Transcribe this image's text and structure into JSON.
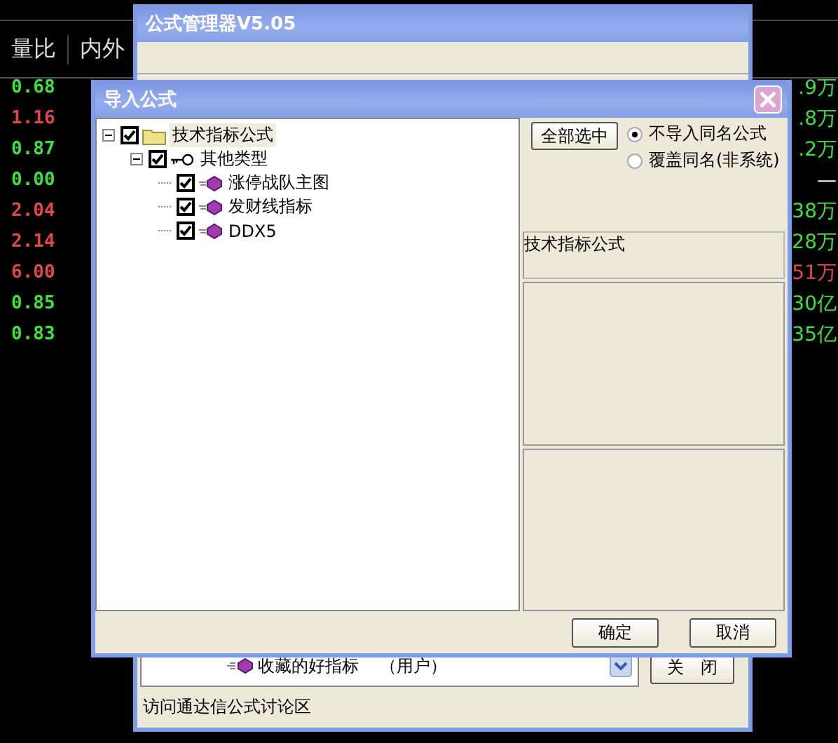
{
  "background_table": {
    "columns": [
      "量比",
      "内外"
    ],
    "left_values": [
      {
        "text": "0.68",
        "color": "#3ee03e"
      },
      {
        "text": "1.16",
        "color": "#e04848"
      },
      {
        "text": "0.87",
        "color": "#3ee03e"
      },
      {
        "text": "0.00",
        "color": "#3ee03e"
      },
      {
        "text": "2.04",
        "color": "#e04848"
      },
      {
        "text": "2.14",
        "color": "#e04848"
      },
      {
        "text": "6.00",
        "color": "#e04848"
      },
      {
        "text": "0.85",
        "color": "#3ee03e"
      },
      {
        "text": "0.83",
        "color": "#3ee03e"
      }
    ],
    "right_values": [
      {
        "text": ".9万",
        "color": "#3ee03e"
      },
      {
        "text": ".8万",
        "color": "#3ee03e"
      },
      {
        "text": ".2万",
        "color": "#3ee03e"
      },
      {
        "text": "—",
        "color": "#ffffff"
      },
      {
        "text": "38万",
        "color": "#3ee03e"
      },
      {
        "text": "28万",
        "color": "#3ee03e"
      },
      {
        "text": "51万",
        "color": "#e04848"
      },
      {
        "text": "30亿",
        "color": "#3ee03e"
      },
      {
        "text": "35亿",
        "color": "#3ee03e"
      }
    ]
  },
  "manager_window": {
    "title": "公式管理器V5.05",
    "list_item": {
      "label": "收藏的好指标",
      "tag": "（用户）"
    },
    "close_button": "关　闭",
    "status": "访问通达信公式讨论区"
  },
  "import_dialog": {
    "title": "导入公式",
    "tree": [
      {
        "label": "技术指标公式",
        "kind": "folder",
        "checked": true,
        "expanded": true,
        "selected": true,
        "children": [
          {
            "label": "其他类型",
            "kind": "key",
            "checked": true,
            "expanded": true,
            "selected": false,
            "children": [
              {
                "label": "涨停战队主图",
                "kind": "formula",
                "checked": true,
                "selected": false
              },
              {
                "label": "发财线指标",
                "kind": "formula",
                "checked": true,
                "selected": false
              },
              {
                "label": "DDX5",
                "kind": "formula",
                "checked": true,
                "selected": false
              }
            ]
          }
        ]
      }
    ],
    "select_all_button": "全部选中",
    "options": [
      {
        "label": "不导入同名公式",
        "selected": true
      },
      {
        "label": "覆盖同名(非系统)",
        "selected": false
      }
    ],
    "info_label": "技术指标公式",
    "buttons": [
      "确定",
      "取消"
    ]
  }
}
